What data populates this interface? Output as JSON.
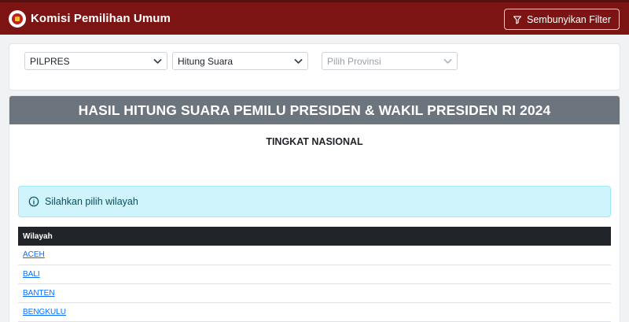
{
  "header": {
    "brand_title": "Komisi Pemilihan Umum",
    "filter_button_label": "Sembunyikan Filter"
  },
  "filters": {
    "election_type": "PILPRES",
    "count_type": "Hitung Suara",
    "province_placeholder": "Pilih Provinsi"
  },
  "main": {
    "title": "HASIL HITUNG SUARA PEMILU PRESIDEN & WAKIL PRESIDEN RI 2024",
    "subtitle": "TINGKAT NASIONAL",
    "alert_text": "Silahkan pilih wilayah",
    "table": {
      "column_header": "Wilayah",
      "rows": [
        "ACEH",
        "BALI",
        "BANTEN",
        "BENGKULU"
      ]
    }
  },
  "colors": {
    "navbar": "#7d1414",
    "card_header": "#6c757d",
    "alert_bg": "#cff4fc",
    "table_header": "#212529",
    "link": "#0d6efd"
  }
}
